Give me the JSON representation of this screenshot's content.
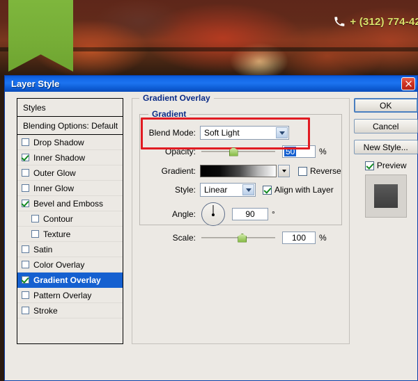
{
  "background": {
    "phone_icon": "phone-icon",
    "phone_number": "+ (312) 774-42",
    "ribbon_color": "#7eb63d",
    "accent_color": "#d8e06a"
  },
  "dialog": {
    "title": "Layer Style",
    "close_icon": "close-icon",
    "titlebar_color": "#1468e8"
  },
  "styles_panel": {
    "header": "Styles",
    "blending_options": "Blending Options: Default",
    "items": [
      {
        "label": "Drop Shadow",
        "checked": false,
        "indent": false,
        "selected": false
      },
      {
        "label": "Inner Shadow",
        "checked": true,
        "indent": false,
        "selected": false
      },
      {
        "label": "Outer Glow",
        "checked": false,
        "indent": false,
        "selected": false
      },
      {
        "label": "Inner Glow",
        "checked": false,
        "indent": false,
        "selected": false
      },
      {
        "label": "Bevel and Emboss",
        "checked": true,
        "indent": false,
        "selected": false
      },
      {
        "label": "Contour",
        "checked": false,
        "indent": true,
        "selected": false
      },
      {
        "label": "Texture",
        "checked": false,
        "indent": true,
        "selected": false
      },
      {
        "label": "Satin",
        "checked": false,
        "indent": false,
        "selected": false
      },
      {
        "label": "Color Overlay",
        "checked": false,
        "indent": false,
        "selected": false
      },
      {
        "label": "Gradient Overlay",
        "checked": true,
        "indent": false,
        "selected": true
      },
      {
        "label": "Pattern Overlay",
        "checked": false,
        "indent": false,
        "selected": false
      },
      {
        "label": "Stroke",
        "checked": false,
        "indent": false,
        "selected": false
      }
    ]
  },
  "gradient_overlay": {
    "section_title": "Gradient Overlay",
    "group_title": "Gradient",
    "blend_mode": {
      "label": "Blend Mode:",
      "value": "Soft Light",
      "icon": "chevron-down-icon"
    },
    "opacity": {
      "label": "Opacity:",
      "value": "50",
      "unit": "%",
      "slider_percent": 43
    },
    "gradient": {
      "label": "Gradient:",
      "icon": "chevron-down-icon",
      "from_color": "#000000",
      "to_color": "#ffffff"
    },
    "reverse": {
      "label": "Reverse",
      "checked": false
    },
    "style": {
      "label": "Style:",
      "value": "Linear",
      "icon": "chevron-down-icon"
    },
    "align_with_layer": {
      "label": "Align with Layer",
      "checked": true
    },
    "angle": {
      "label": "Angle:",
      "value": "90",
      "unit": "°",
      "dial_icon": "angle-dial-icon"
    },
    "scale": {
      "label": "Scale:",
      "value": "100",
      "unit": "%",
      "slider_percent": 55
    },
    "annotation_color": "#e11b22"
  },
  "buttons": {
    "ok": "OK",
    "cancel": "Cancel",
    "new_style": "New Style...",
    "preview": {
      "label": "Preview",
      "checked": true
    }
  }
}
